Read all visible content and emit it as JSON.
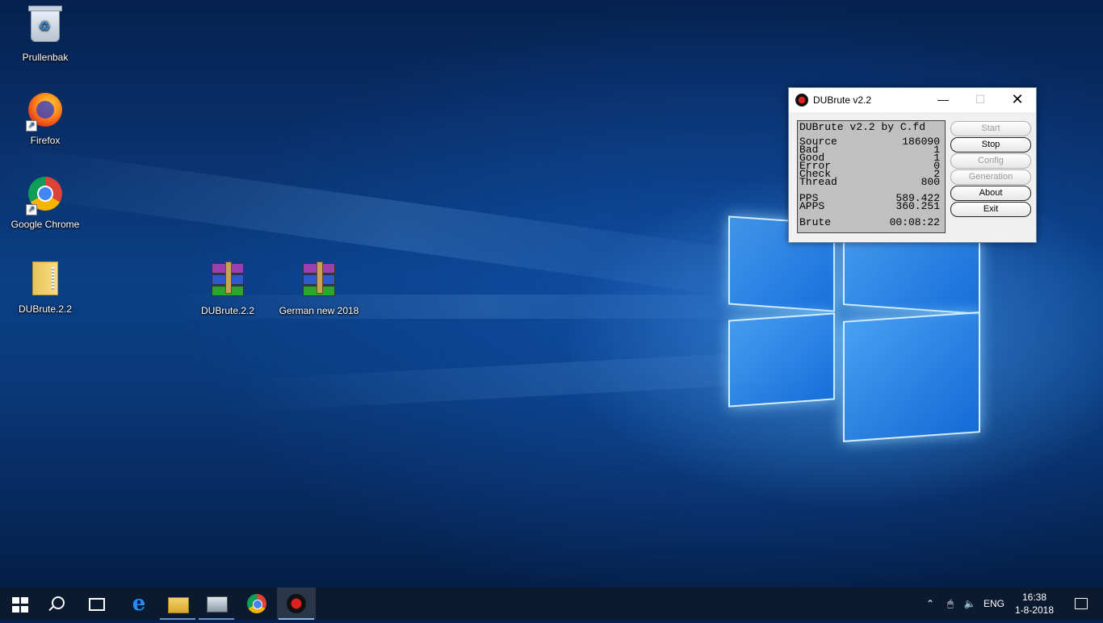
{
  "desktop": {
    "icons": [
      {
        "label": "Prullenbak"
      },
      {
        "label": "Firefox"
      },
      {
        "label": "Google Chrome"
      },
      {
        "label": "DUBrute.2.2"
      },
      {
        "label": "DUBrute.2.2"
      },
      {
        "label": "German new 2018"
      }
    ]
  },
  "window": {
    "title": "DUBrute v2.2",
    "header": "DUBrute v2.2 by C.fd",
    "stats": [
      {
        "label": "Source",
        "value": "186090"
      },
      {
        "label": "Bad",
        "value": "1"
      },
      {
        "label": "Good",
        "value": "1"
      },
      {
        "label": "Error",
        "value": "0"
      },
      {
        "label": "Check",
        "value": "2"
      },
      {
        "label": "Thread",
        "value": "800"
      },
      {
        "label": "PPS",
        "value": "589.422"
      },
      {
        "label": "APPS",
        "value": "360.251"
      },
      {
        "label": "Brute",
        "value": "00:08:22"
      }
    ],
    "buttons": {
      "start": "Start",
      "stop": "Stop",
      "config": "Config",
      "generation": "Generation",
      "about": "About",
      "exit": "Exit"
    }
  },
  "taskbar": {
    "language": "ENG",
    "time": "16:38",
    "date": "1-8-2018"
  }
}
